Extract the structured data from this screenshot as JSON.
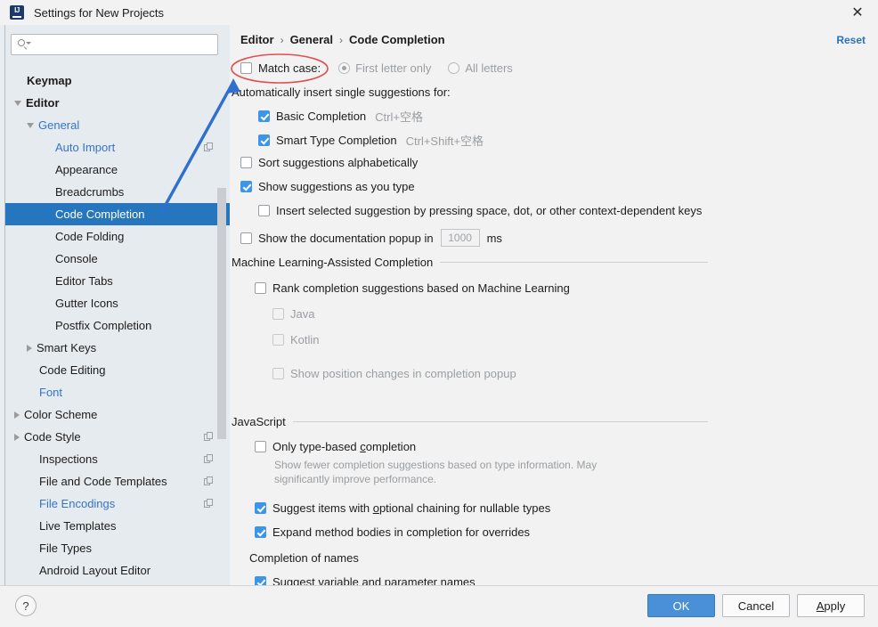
{
  "window": {
    "title": "Settings for New Projects",
    "app_icon": "intellij-idea-icon",
    "close_icon": "close-icon"
  },
  "search": {
    "placeholder": "",
    "value": "",
    "icon": "search-icon"
  },
  "sidebar": {
    "items": [
      {
        "label": "Keymap",
        "indent": 0,
        "twisty": "none",
        "bold": true,
        "blue": false,
        "copy": false,
        "selected": false
      },
      {
        "label": "Editor",
        "indent": 0,
        "twisty": "down",
        "bold": true,
        "blue": false,
        "copy": false,
        "selected": false
      },
      {
        "label": "General",
        "indent": 1,
        "twisty": "down",
        "bold": false,
        "blue": true,
        "copy": false,
        "selected": false
      },
      {
        "label": "Auto Import",
        "indent": 2,
        "twisty": "none",
        "bold": false,
        "blue": true,
        "copy": true,
        "selected": false
      },
      {
        "label": "Appearance",
        "indent": 2,
        "twisty": "none",
        "bold": false,
        "blue": false,
        "copy": false,
        "selected": false
      },
      {
        "label": "Breadcrumbs",
        "indent": 2,
        "twisty": "none",
        "bold": false,
        "blue": false,
        "copy": false,
        "selected": false
      },
      {
        "label": "Code Completion",
        "indent": 2,
        "twisty": "none",
        "bold": false,
        "blue": false,
        "copy": false,
        "selected": true
      },
      {
        "label": "Code Folding",
        "indent": 2,
        "twisty": "none",
        "bold": false,
        "blue": false,
        "copy": false,
        "selected": false
      },
      {
        "label": "Console",
        "indent": 2,
        "twisty": "none",
        "bold": false,
        "blue": false,
        "copy": false,
        "selected": false
      },
      {
        "label": "Editor Tabs",
        "indent": 2,
        "twisty": "none",
        "bold": false,
        "blue": false,
        "copy": false,
        "selected": false
      },
      {
        "label": "Gutter Icons",
        "indent": 2,
        "twisty": "none",
        "bold": false,
        "blue": false,
        "copy": false,
        "selected": false
      },
      {
        "label": "Postfix Completion",
        "indent": 2,
        "twisty": "none",
        "bold": false,
        "blue": false,
        "copy": false,
        "selected": false
      },
      {
        "label": "Smart Keys",
        "indent": 1,
        "twisty": "right",
        "bold": false,
        "blue": false,
        "copy": false,
        "selected": false
      },
      {
        "label": "Code Editing",
        "indent": 1,
        "twisty": "none",
        "bold": false,
        "blue": false,
        "copy": false,
        "selected": false
      },
      {
        "label": "Font",
        "indent": 1,
        "twisty": "none",
        "bold": false,
        "blue": true,
        "copy": false,
        "selected": false
      },
      {
        "label": "Color Scheme",
        "indent": 0,
        "twisty": "right",
        "bold": false,
        "blue": false,
        "copy": false,
        "selected": false
      },
      {
        "label": "Code Style",
        "indent": 0,
        "twisty": "right",
        "bold": false,
        "blue": false,
        "copy": true,
        "selected": false
      },
      {
        "label": "Inspections",
        "indent": 1,
        "twisty": "none",
        "bold": false,
        "blue": false,
        "copy": true,
        "selected": false
      },
      {
        "label": "File and Code Templates",
        "indent": 1,
        "twisty": "none",
        "bold": false,
        "blue": false,
        "copy": true,
        "selected": false
      },
      {
        "label": "File Encodings",
        "indent": 1,
        "twisty": "none",
        "bold": false,
        "blue": true,
        "copy": true,
        "selected": false
      },
      {
        "label": "Live Templates",
        "indent": 1,
        "twisty": "none",
        "bold": false,
        "blue": false,
        "copy": false,
        "selected": false
      },
      {
        "label": "File Types",
        "indent": 1,
        "twisty": "none",
        "bold": false,
        "blue": false,
        "copy": false,
        "selected": false
      },
      {
        "label": "Android Layout Editor",
        "indent": 1,
        "twisty": "none",
        "bold": false,
        "blue": false,
        "copy": false,
        "selected": false
      }
    ]
  },
  "breadcrumb": {
    "crumb1": "Editor",
    "crumb2": "General",
    "crumb3": "Code Completion",
    "separator": "›"
  },
  "reset": {
    "label": "Reset"
  },
  "main": {
    "match_case": {
      "label": "Match case:",
      "checked": false,
      "first_letter_only": "First letter only",
      "first_letter_only_selected": true,
      "all_letters": "All letters",
      "all_letters_selected": false,
      "radios_disabled": true
    },
    "auto_insert_label": "Automatically insert single suggestions for:",
    "basic_completion": {
      "label": "Basic Completion",
      "shortcut": "Ctrl+空格",
      "checked": true
    },
    "smart_type_completion": {
      "label": "Smart Type Completion",
      "shortcut": "Ctrl+Shift+空格",
      "checked": true
    },
    "sort_alphabetically": {
      "label": "Sort suggestions alphabetically",
      "checked": false
    },
    "show_as_you_type": {
      "label": "Show suggestions as you type",
      "checked": true
    },
    "insert_selected": {
      "label": "Insert selected suggestion by pressing space, dot, or other context-dependent keys",
      "checked": false
    },
    "doc_popup": {
      "label": "Show the documentation popup in",
      "checked": false,
      "delay_value": "1000",
      "unit": "ms"
    },
    "ml_section": {
      "title": "Machine Learning-Assisted Completion",
      "rank": {
        "label": "Rank completion suggestions based on Machine Learning",
        "checked": false
      },
      "java": {
        "label": "Java",
        "checked": false,
        "disabled": true
      },
      "kotlin": {
        "label": "Kotlin",
        "checked": false,
        "disabled": true
      },
      "show_position_changes": {
        "label": "Show position changes in completion popup",
        "checked": false,
        "disabled": true
      }
    },
    "js_section": {
      "title": "JavaScript",
      "only_type_based": {
        "label": "Only type-based completion",
        "checked": false
      },
      "only_type_based_desc": "Show fewer completion suggestions based on type information. May significantly improve performance.",
      "optional_chaining": {
        "label": "Suggest items with optional chaining for nullable types",
        "checked": true
      },
      "expand_method_bodies": {
        "label": "Expand method bodies in completion for overrides",
        "checked": true
      },
      "completion_of_names": "Completion of names",
      "suggest_variable_names": {
        "label": "Suggest variable and parameter names",
        "checked": true
      }
    }
  },
  "footer": {
    "help": "?",
    "ok": "OK",
    "cancel": "Cancel",
    "apply": "Apply"
  },
  "annotations": {
    "ellipse_color": "#e05050",
    "arrow_color": "#2f6fd0"
  }
}
